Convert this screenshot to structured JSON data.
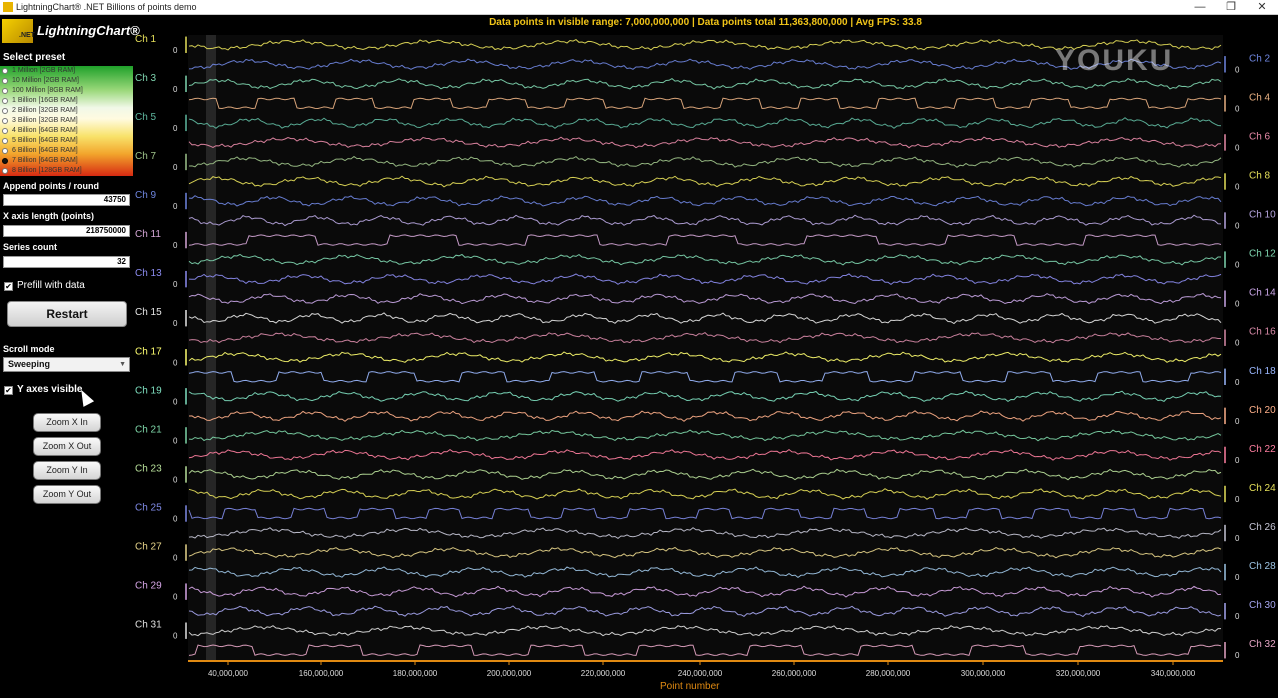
{
  "window": {
    "title": "LightningChart® .NET Billions of points demo",
    "minimize": "—",
    "maximize": "❐",
    "close": "✕"
  },
  "brand": {
    "name": "LightningChart",
    "registered": "®",
    "sub": ".NET"
  },
  "presets": {
    "title": "Select preset",
    "items": [
      "1 Million [2GB RAM]",
      "10 Million [2GB RAM]",
      "100 Million [8GB RAM]",
      "1 Billion [16GB RAM]",
      "2 Billion [32GB RAM]",
      "3 Billion [32GB RAM]",
      "4 Billion [64GB RAM]",
      "5 Billion [64GB RAM]",
      "6 Billion [64GB RAM]",
      "7 Billion [64GB RAM]",
      "8 Billion [128GB RAM]"
    ],
    "selected_index": 9
  },
  "settings": {
    "append_label": "Append points / round",
    "append_value": "43750",
    "xlen_label": "X axis length (points)",
    "xlen_value": "218750000",
    "series_label": "Series count",
    "series_value": "32",
    "prefill_label": "Prefill with data",
    "prefill_checked": true,
    "restart_label": "Restart",
    "scroll_label": "Scroll mode",
    "scroll_value": "Sweeping",
    "yaxes_label": "Y axes visible",
    "yaxes_checked": true,
    "check_glyph": "✔",
    "dropdown_glyph": "▼"
  },
  "zoom_buttons": [
    "Zoom X In",
    "Zoom X Out",
    "Zoom Y In",
    "Zoom Y Out"
  ],
  "header": {
    "stats": "Data points in visible range: 7,000,000,000 | Data points total 11,363,800,000 | Avg FPS: 33.8"
  },
  "watermark": "YOUKU",
  "colors": {
    "header_text": "#f0c419",
    "axis": "#e08a12",
    "channel_palette": [
      "#e6e05a",
      "#6f86e0",
      "#7fd6b0",
      "#e8b082",
      "#5fb8a0",
      "#e88aa8",
      "#9ec38a",
      "#e6e05a",
      "#6f86e0",
      "#b7a6e0",
      "#d4a6d6",
      "#7fd6b0",
      "#8c8cf0",
      "#c9a6e6",
      "#e6e6e6",
      "#d88aa8",
      "#ffff70",
      "#9bb8ff",
      "#7fe0c0",
      "#ffb08a",
      "#7ed6a8",
      "#ff7fa0",
      "#b8e09a",
      "#e6e05a",
      "#7f8ae6",
      "#c6c6d6",
      "#e6d48a",
      "#9ec6e6",
      "#d6a6e6",
      "#a6a6f0",
      "#e0e0e0",
      "#e6a6c6"
    ]
  },
  "chart_data": {
    "type": "line",
    "series": [
      {
        "name": "Ch 1",
        "side": "left"
      },
      {
        "name": "Ch 2",
        "side": "right"
      },
      {
        "name": "Ch 3",
        "side": "left"
      },
      {
        "name": "Ch 4",
        "side": "right"
      },
      {
        "name": "Ch 5",
        "side": "left"
      },
      {
        "name": "Ch 6",
        "side": "right"
      },
      {
        "name": "Ch 7",
        "side": "left"
      },
      {
        "name": "Ch 8",
        "side": "right"
      },
      {
        "name": "Ch 9",
        "side": "left"
      },
      {
        "name": "Ch 10",
        "side": "right"
      },
      {
        "name": "Ch 11",
        "side": "left"
      },
      {
        "name": "Ch 12",
        "side": "right"
      },
      {
        "name": "Ch 13",
        "side": "left"
      },
      {
        "name": "Ch 14",
        "side": "right"
      },
      {
        "name": "Ch 15",
        "side": "left"
      },
      {
        "name": "Ch 16",
        "side": "right"
      },
      {
        "name": "Ch 17",
        "side": "left"
      },
      {
        "name": "Ch 18",
        "side": "right"
      },
      {
        "name": "Ch 19",
        "side": "left"
      },
      {
        "name": "Ch 20",
        "side": "right"
      },
      {
        "name": "Ch 21",
        "side": "left"
      },
      {
        "name": "Ch 22",
        "side": "right"
      },
      {
        "name": "Ch 23",
        "side": "left"
      },
      {
        "name": "Ch 24",
        "side": "right"
      },
      {
        "name": "Ch 25",
        "side": "left"
      },
      {
        "name": "Ch 26",
        "side": "right"
      },
      {
        "name": "Ch 27",
        "side": "left"
      },
      {
        "name": "Ch 28",
        "side": "right"
      },
      {
        "name": "Ch 29",
        "side": "left"
      },
      {
        "name": "Ch 30",
        "side": "right"
      },
      {
        "name": "Ch 31",
        "side": "left"
      },
      {
        "name": "Ch 32",
        "side": "right"
      }
    ],
    "y_tick_label": "0",
    "x_tick_labels": [
      "40,000,000",
      "160,000,000",
      "180,000,000",
      "200,000,000",
      "220,000,000",
      "240,000,000",
      "260,000,000",
      "280,000,000",
      "300,000,000",
      "320,000,000",
      "340,000,000"
    ],
    "xlabel": "Point number"
  }
}
